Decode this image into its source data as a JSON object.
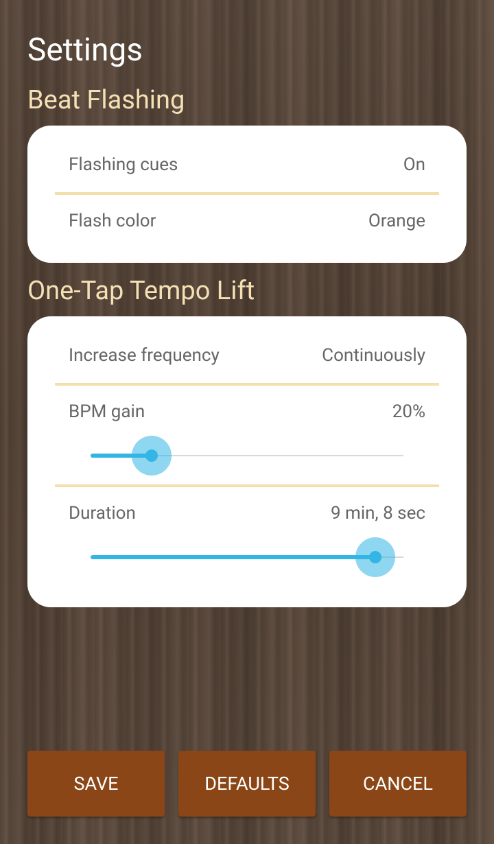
{
  "title": "Settings",
  "beat_flashing": {
    "heading": "Beat Flashing",
    "flashing_cues": {
      "label": "Flashing cues",
      "value": "On"
    },
    "flash_color": {
      "label": "Flash color",
      "value": "Orange"
    }
  },
  "tempo_lift": {
    "heading": "One-Tap Tempo Lift",
    "increase_frequency": {
      "label": "Increase frequency",
      "value": "Continuously"
    },
    "bpm_gain": {
      "label": "BPM gain",
      "value": "20%",
      "slider_fraction": 0.195
    },
    "duration": {
      "label": "Duration",
      "value": "9 min, 8 sec",
      "slider_fraction": 0.91
    }
  },
  "buttons": {
    "save": "SAVE",
    "defaults": "DEFAULTS",
    "cancel": "CANCEL"
  },
  "colors": {
    "accent": "#33b5e5",
    "button": "#8a4616",
    "section_heading": "#f4e0b4",
    "divider": "#f3dfac"
  }
}
